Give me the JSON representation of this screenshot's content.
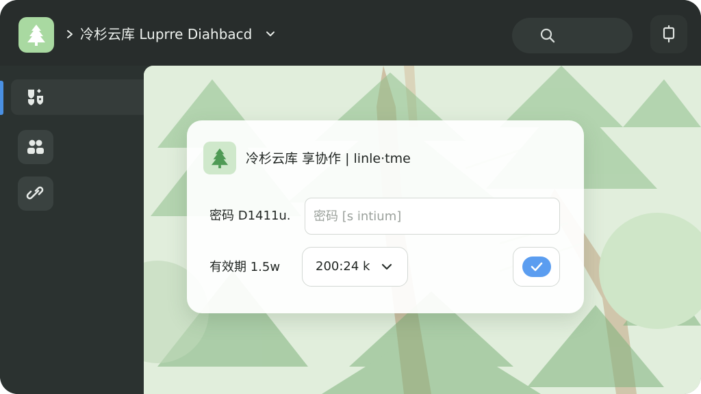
{
  "header": {
    "title": "冷杉云库 Luprre Diahbacd",
    "logo_icon": "fir-tree-icon",
    "search_icon": "search-icon",
    "right_icon": "device-icon"
  },
  "sidebar": {
    "items": [
      {
        "icon": "shield-grid-icon",
        "active": true
      },
      {
        "icon": "users-icon",
        "active": false
      },
      {
        "icon": "link-icon",
        "active": false
      }
    ],
    "accent_color": "#4a90e2"
  },
  "dialog": {
    "title": "冷杉云库 享协作 | linle·tme",
    "password_label": "密码 D1411u.",
    "password_placeholder": "密码 [s intium]",
    "password_value": "",
    "expiry_label": "有效期 1.5w",
    "expiry_value": "200:24 k",
    "confirm_icon": "check-icon",
    "confirm_color": "#5b9df0"
  },
  "colors": {
    "brand_green": "#a9d9a1",
    "topbar": "#282d2c",
    "sidebar": "#2b3230",
    "background_scene": "#e3efde"
  }
}
